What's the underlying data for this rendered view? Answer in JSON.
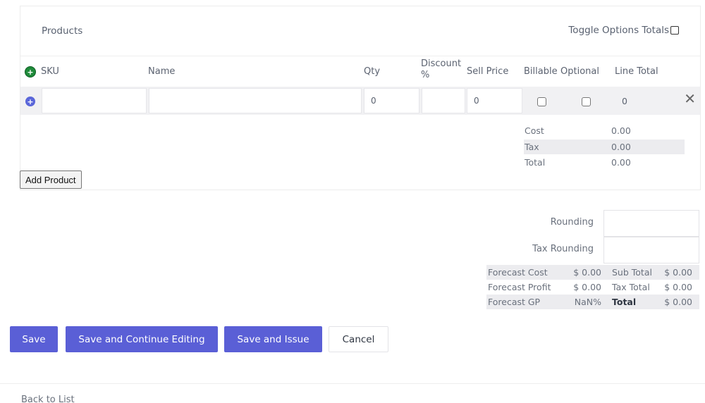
{
  "products": {
    "title": "Products",
    "toggle_options_totals": "Toggle Options Totals",
    "columns": {
      "sku": "SKU",
      "name": "Name",
      "qty": "Qty",
      "discount_line1": "Discount",
      "discount_line2": "%",
      "sell_price": "Sell Price",
      "billable": "Billable",
      "optional": "Optional",
      "line_total": "Line Total"
    },
    "row": {
      "sku": "",
      "name": "",
      "qty": "0",
      "discount": "",
      "sell_price": "0",
      "billable": false,
      "optional": false,
      "line_total": "0"
    },
    "summary": [
      {
        "label": "Cost",
        "value": "0.00"
      },
      {
        "label": "Tax",
        "value": "0.00"
      },
      {
        "label": "Total",
        "value": "0.00"
      }
    ],
    "add_product_label": "Add Product"
  },
  "rounding": {
    "rounding_label": "Rounding",
    "rounding_value": "",
    "tax_rounding_label": "Tax Rounding",
    "tax_rounding_value": ""
  },
  "forecast": [
    {
      "label": "Forecast Cost",
      "value": "$ 0.00",
      "total_label": "Sub Total",
      "total_value": "$ 0.00"
    },
    {
      "label": "Forecast Profit",
      "value": "$ 0.00",
      "total_label": "Tax Total",
      "total_value": "$ 0.00"
    },
    {
      "label": "Forecast GP",
      "value": "NaN%",
      "total_label": "Total",
      "total_value": "$ 0.00"
    }
  ],
  "actions": {
    "save": "Save",
    "save_continue": "Save and Continue Editing",
    "save_issue": "Save and Issue",
    "cancel": "Cancel"
  },
  "back_to_list": "Back to List",
  "colors": {
    "primary": "#5a5fd6",
    "add_green": "#1f8a3a",
    "row_add_blue": "#5a66d9"
  }
}
